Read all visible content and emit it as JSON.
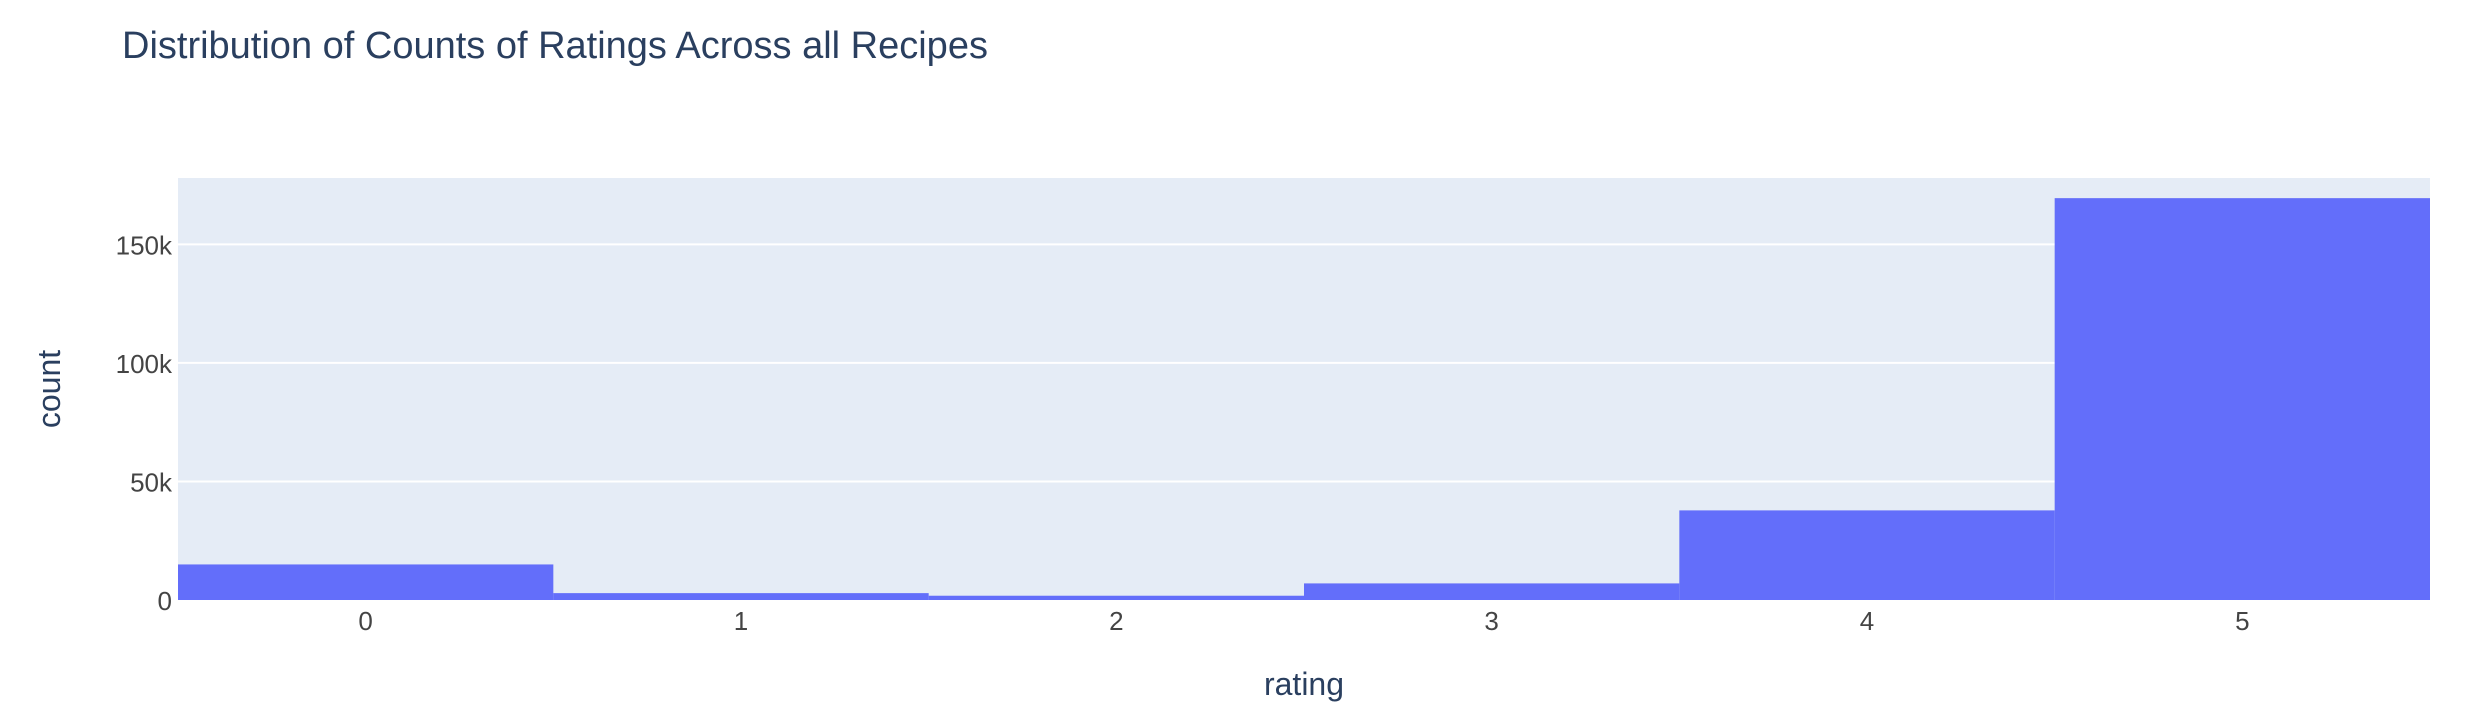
{
  "chart_data": {
    "type": "bar",
    "title": "Distribution of Counts of Ratings Across all Recipes",
    "xlabel": "rating",
    "ylabel": "count",
    "categories": [
      "0",
      "1",
      "2",
      "3",
      "4",
      "5"
    ],
    "values": [
      15000,
      2900,
      1800,
      7000,
      37800,
      169500
    ],
    "ylim": [
      0,
      178000
    ],
    "y_ticks": [
      {
        "value": 0,
        "label": "0"
      },
      {
        "value": 50000,
        "label": "50k"
      },
      {
        "value": 100000,
        "label": "100k"
      },
      {
        "value": 150000,
        "label": "150k"
      }
    ],
    "grid": true,
    "colors": {
      "bar": "#636efa",
      "plot_bg": "#e5ecf6",
      "grid": "#ffffff",
      "text": "#2a3f5f",
      "tick_text": "#444444"
    }
  }
}
